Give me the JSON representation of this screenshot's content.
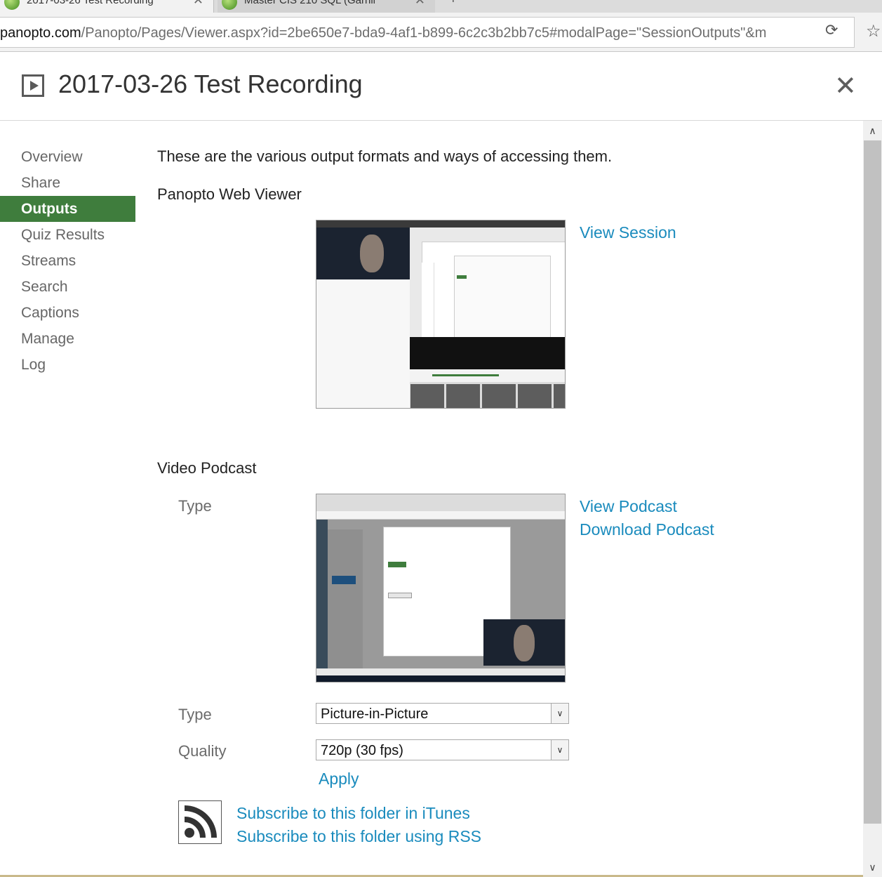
{
  "browser": {
    "tabs": [
      {
        "title": "2017-03-26 Test Recording",
        "close": "✕"
      },
      {
        "title": "Master CIS 210 SQL (Garnil",
        "close": "✕"
      }
    ],
    "new_tab": "+",
    "url_host": "panopto.com",
    "url_path": "/Panopto/Pages/Viewer.aspx?id=2be650e7-bda9-4af1-b899-6c2c3b2bb7c5#modalPage=\"SessionOutputs\"&m",
    "reload_icon": "reload-icon",
    "star_icon": "bookmark-star-icon"
  },
  "modal": {
    "title": "2017-03-26 Test Recording",
    "close": "✕"
  },
  "sidebar": {
    "items": [
      {
        "label": "Overview",
        "active": false
      },
      {
        "label": "Share",
        "active": false
      },
      {
        "label": "Outputs",
        "active": true
      },
      {
        "label": "Quiz Results",
        "active": false
      },
      {
        "label": "Streams",
        "active": false
      },
      {
        "label": "Search",
        "active": false
      },
      {
        "label": "Captions",
        "active": false
      },
      {
        "label": "Manage",
        "active": false
      },
      {
        "label": "Log",
        "active": false
      }
    ]
  },
  "main": {
    "intro": "These are the various output formats and ways of accessing them.",
    "web_viewer": {
      "heading": "Panopto Web Viewer",
      "link": "View Session"
    },
    "video_podcast": {
      "heading": "Video Podcast",
      "type_label": "Type",
      "links": [
        "View Podcast",
        "Download Podcast"
      ],
      "type_select_label": "Type",
      "type_value": "Picture-in-Picture",
      "quality_label": "Quality",
      "quality_value": "720p (30 fps)",
      "apply": "Apply",
      "subscribe_itunes": "Subscribe to this folder in iTunes",
      "subscribe_rss": "Subscribe to this folder using RSS"
    }
  },
  "colors": {
    "accent_green": "#3f7d3d",
    "link_blue": "#1a8bbd"
  }
}
